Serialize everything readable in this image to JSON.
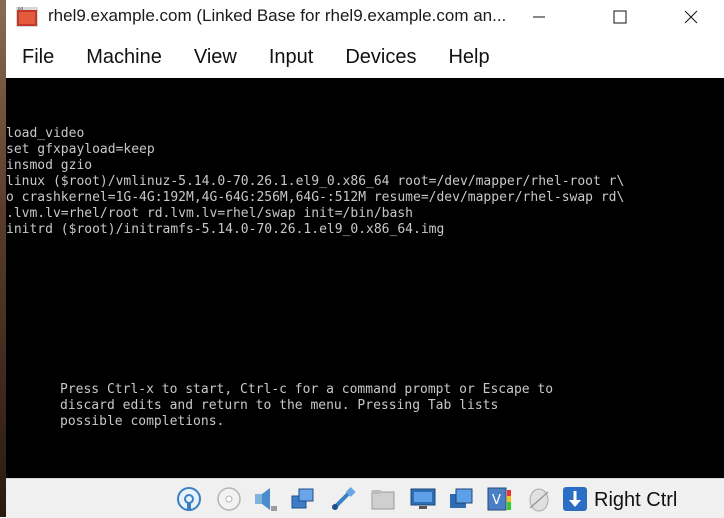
{
  "window": {
    "title": "rhel9.example.com (Linked Base for rhel9.example.com an...",
    "icon": "virtualbox-app-icon",
    "controls": [
      "minimize",
      "maximize",
      "close"
    ]
  },
  "menubar": {
    "items": [
      "File",
      "Machine",
      "View",
      "Input",
      "Devices",
      "Help"
    ]
  },
  "console": {
    "lines": [
      "load_video",
      "set gfxpayload=keep",
      "insmod gzio",
      "linux ($root)/vmlinuz-5.14.0-70.26.1.el9_0.x86_64 root=/dev/mapper/rhel-root r\\",
      "o crashkernel=1G-4G:192M,4G-64G:256M,64G-:512M resume=/dev/mapper/rhel-swap rd\\",
      ".lvm.lv=rhel/root rd.lvm.lv=rhel/swap init=/bin/bash",
      "initrd ($root)/initramfs-5.14.0-70.26.1.el9_0.x86_64.img"
    ],
    "help": [
      "Press Ctrl-x to start, Ctrl-c for a command prompt or Escape to",
      "discard edits and return to the menu. Pressing Tab lists",
      "possible completions."
    ]
  },
  "statusbar": {
    "icons": [
      "hard-disk-icon",
      "optical-drive-icon",
      "audio-icon",
      "network-icon",
      "usb-icon",
      "shared-folders-icon",
      "display-icon",
      "video-capture-icon",
      "cpu-activity-icon",
      "mouse-integration-icon",
      "keyboard-arrow-icon"
    ],
    "host_key": "Right Ctrl"
  }
}
